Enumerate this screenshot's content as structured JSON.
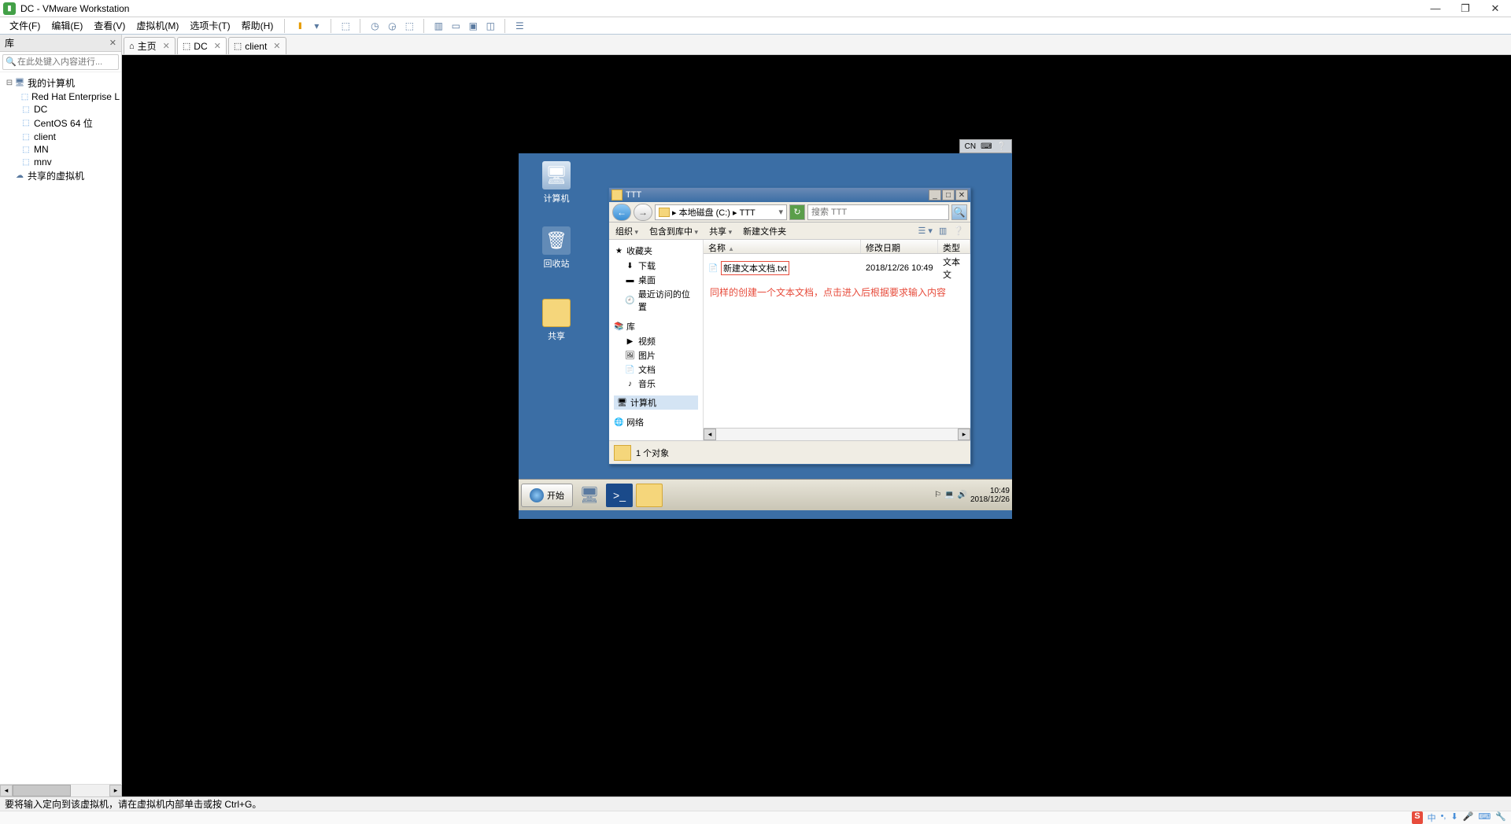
{
  "window": {
    "title": "DC - VMware Workstation",
    "min": "—",
    "max": "❐",
    "close": "✕"
  },
  "menu": {
    "file": "文件(F)",
    "edit": "编辑(E)",
    "view": "查看(V)",
    "vm": "虚拟机(M)",
    "tabs": "选项卡(T)",
    "help": "帮助(H)"
  },
  "sidebar": {
    "header": "库",
    "search_ph": "在此处键入内容进行...",
    "root": "我的计算机",
    "items": [
      "Red Hat Enterprise L",
      "DC",
      "CentOS 64 位",
      "client",
      "MN",
      "mnv"
    ],
    "shared": "共享的虚拟机"
  },
  "tabs": {
    "home": "主页",
    "dc": "DC",
    "client": "client"
  },
  "deskicons": {
    "computer": "计算机",
    "recycle": "回收站",
    "share": "共享"
  },
  "explorer": {
    "title": "TTT",
    "address": "▸ 本地磁盘 (C:) ▸ TTT",
    "search_ph": "搜索 TTT",
    "toolbar": {
      "org": "组织",
      "lib": "包含到库中",
      "share": "共享",
      "new": "新建文件夹"
    },
    "nav": {
      "fav": "收藏夹",
      "dl": "下载",
      "desk": "桌面",
      "recent": "最近访问的位置",
      "lib_h": "库",
      "video": "视频",
      "pic": "图片",
      "doc": "文档",
      "music": "音乐",
      "computer": "计算机",
      "network": "网络"
    },
    "cols": {
      "name": "名称",
      "date": "修改日期",
      "type": "类型"
    },
    "file": {
      "name": "新建文本文档.txt",
      "date": "2018/12/26 10:49",
      "type": "文本文"
    },
    "annotate": "同样的创建一个文本文档，点击进入后根据要求输入内容",
    "status": "1 个对象"
  },
  "guesttask": {
    "start": "开始",
    "lang_cn": "CN",
    "kb": "⌨",
    "help": "❔",
    "time": "10:49",
    "date": "2018/12/26"
  },
  "vmstatus": "要将输入定向到该虚拟机，请在虚拟机内部单击或按 Ctrl+G。",
  "ostray": {
    "sogou": "S",
    "zhong": "中",
    "dot": "•,",
    "cloud": "⬇",
    "mic": "🎤",
    "kb": "⌨",
    "tool": "🔧"
  }
}
